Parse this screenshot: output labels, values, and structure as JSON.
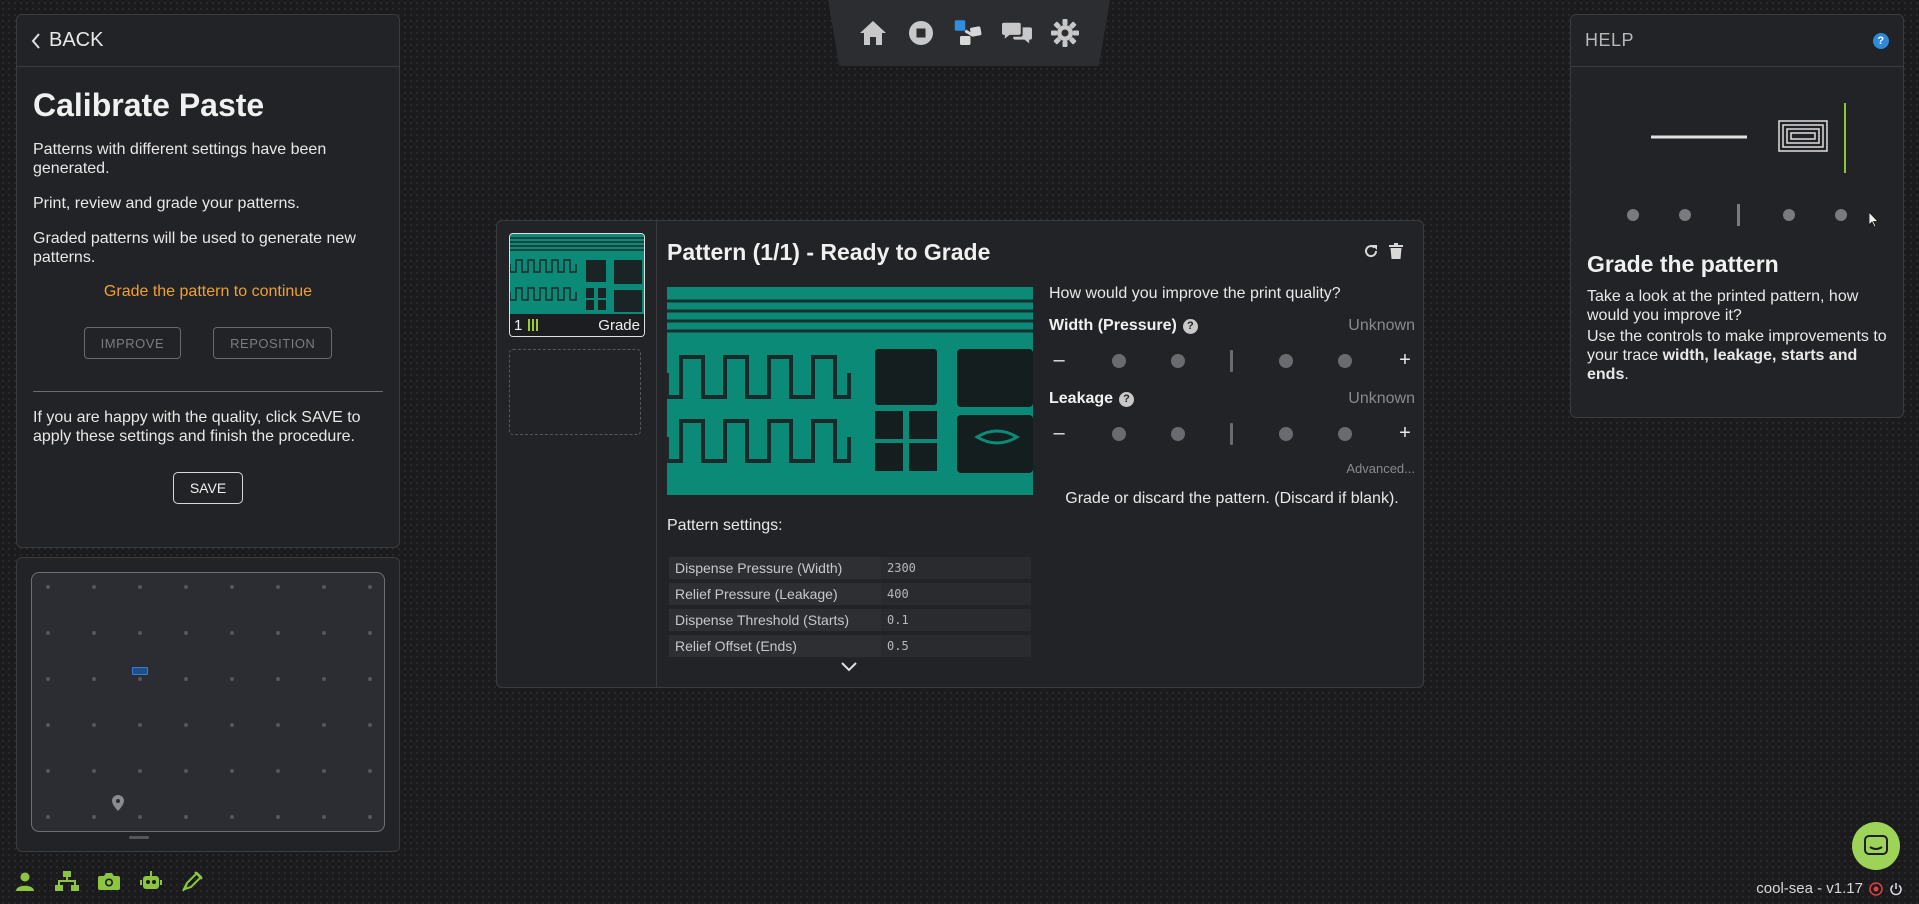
{
  "left": {
    "back_label": "BACK",
    "title": "Calibrate Paste",
    "p1": "Patterns with different settings have been generated.",
    "p2": "Print, review and grade your patterns.",
    "p3": "Graded patterns will be used to generate new patterns.",
    "warning": "Grade the pattern to continue",
    "improve_label": "IMPROVE",
    "reposition_label": "REPOSITION",
    "save_hint": "If you are happy with the quality, click SAVE to apply these settings and finish the procedure.",
    "save_label": "SAVE",
    "warning_color": "#f0a030"
  },
  "nav": {
    "icons": [
      "home-icon",
      "stop-icon",
      "calibrate-icon",
      "chat-icon",
      "gear-icon"
    ],
    "active_color": "#2f8ee0"
  },
  "pattern": {
    "title": "Pattern (1/1) - Ready to Grade",
    "thumb_index": "1",
    "thumb_label": "Grade",
    "settings_label": "Pattern settings:",
    "settings": [
      {
        "name": "Dispense Pressure (Width)",
        "value": "2300"
      },
      {
        "name": "Relief Pressure (Leakage)",
        "value": "400"
      },
      {
        "name": "Dispense Threshold (Starts)",
        "value": "0.1"
      },
      {
        "name": "Relief Offset (Ends)",
        "value": "0.5"
      }
    ],
    "question": "How would you improve the print quality?",
    "width_label": "Width (Pressure)",
    "width_value": "Unknown",
    "leakage_label": "Leakage",
    "leakage_value": "Unknown",
    "advanced_label": "Advanced...",
    "grade_note": "Grade or discard the pattern. (Discard if blank).",
    "image_color": "#0c8a78"
  },
  "help": {
    "header": "HELP",
    "title": "Grade the pattern",
    "p1": "Take a look at the printed pattern, how would you improve it?",
    "p2_a": "Use the controls to make improvements to your trace ",
    "p2_b": "width, leakage, starts and ends",
    "p2_c": "."
  },
  "footer": {
    "version": "cool-sea - v1.17",
    "icons": [
      "user-icon",
      "network-icon",
      "camera-icon",
      "robot-icon",
      "pen-icon"
    ],
    "accent": "#8cc63f"
  }
}
